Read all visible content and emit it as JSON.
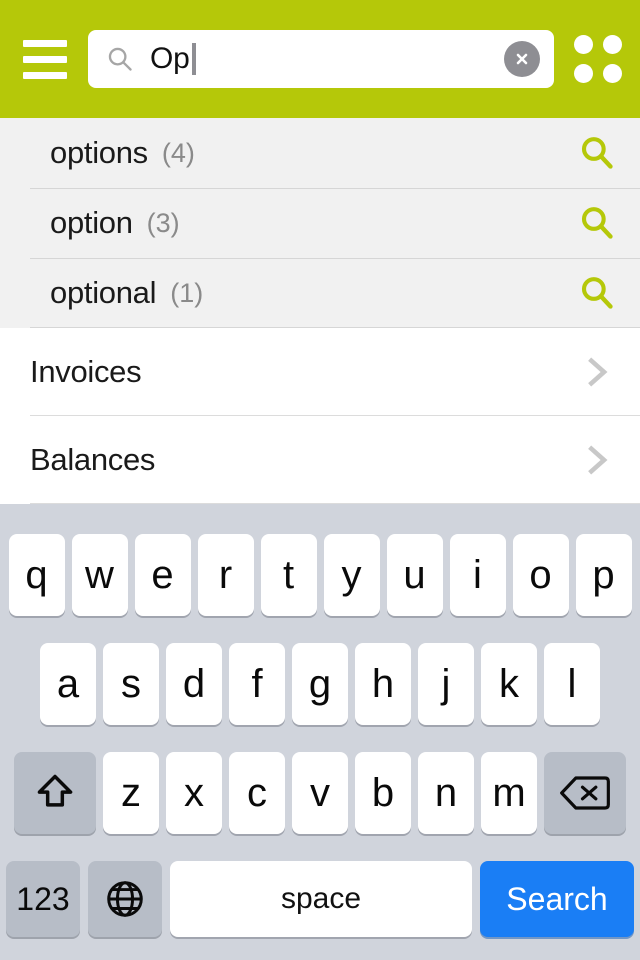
{
  "header": {
    "menu_icon": "hamburger-menu-icon",
    "grid_icon": "grid-apps-icon",
    "search": {
      "icon": "search-icon",
      "value": "Op",
      "placeholder": "Search",
      "clear_icon": "clear-circle-icon"
    },
    "background_color": "#b5c809"
  },
  "suggestions": {
    "items": [
      {
        "label": "options",
        "count": "(4)",
        "icon": "search-icon"
      },
      {
        "label": "option",
        "count": "(3)",
        "icon": "search-icon"
      },
      {
        "label": "optional",
        "count": "(1)",
        "icon": "search-icon"
      }
    ],
    "accent_color": "#b5c809",
    "background_color": "#f1f1f1"
  },
  "list": {
    "items": [
      {
        "label": "Invoices",
        "icon": "chevron-right-icon"
      },
      {
        "label": "Balances",
        "icon": "chevron-right-icon"
      }
    ]
  },
  "keyboard": {
    "row1": [
      "q",
      "w",
      "e",
      "r",
      "t",
      "y",
      "u",
      "i",
      "o",
      "p"
    ],
    "row2": [
      "a",
      "s",
      "d",
      "f",
      "g",
      "h",
      "j",
      "k",
      "l"
    ],
    "row3": [
      "z",
      "x",
      "c",
      "v",
      "b",
      "n",
      "m"
    ],
    "shift_key": {
      "label": "",
      "icon": "shift-arrow-icon"
    },
    "backspace_key": {
      "label": "",
      "icon": "backspace-delete-icon"
    },
    "numeric_key": {
      "label": "123"
    },
    "globe_key": {
      "label": "",
      "icon": "globe-language-icon"
    },
    "space_key": {
      "label": "space"
    },
    "action_key": {
      "label": "Search",
      "color": "#1a7ef5"
    },
    "background_color": "#d0d4dc"
  }
}
